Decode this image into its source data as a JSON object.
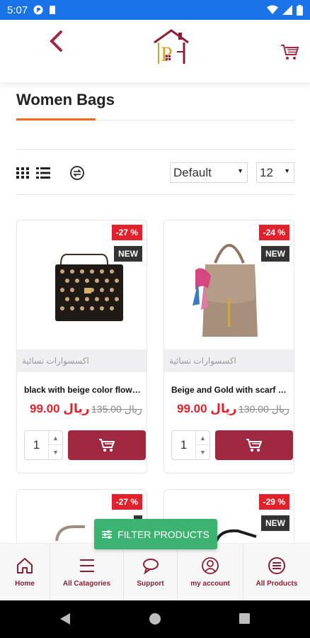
{
  "status_bar": {
    "time": "5:07"
  },
  "header": {
    "back_icon": "chevron-left-icon",
    "logo_letter": "P",
    "cart_icon": "cart-icon"
  },
  "page": {
    "title": "Women Bags"
  },
  "toolbar": {
    "grid_icon": "grid-view-icon",
    "list_icon": "list-view-icon",
    "compare_icon": "sync-icon",
    "sort": {
      "selected": "Default"
    },
    "per_page": {
      "selected": "12"
    }
  },
  "products": [
    {
      "discount": "-27 %",
      "badge": "NEW",
      "category": "اكسسوارات نسائية",
      "name": "black with beige color flowe...",
      "price": "99.00 ريال",
      "old_price": "135.00 ريال",
      "qty": "1"
    },
    {
      "discount": "-24 %",
      "badge": "NEW",
      "category": "اكسسوارات نسائية",
      "name": "Beige and Gold with scarf w...",
      "price": "99.00 ريال",
      "old_price": "130.00 ريال",
      "qty": "1"
    },
    {
      "discount": "-27 %",
      "badge": ""
    },
    {
      "discount": "-29 %",
      "badge": "NEW"
    }
  ],
  "filter_button": {
    "label": "FILTER PRODUCTS"
  },
  "bottom_nav": [
    {
      "label": "Home",
      "icon": "home-icon"
    },
    {
      "label": "All Catagories",
      "icon": "menu-icon"
    },
    {
      "label": "Support",
      "icon": "chat-icon"
    },
    {
      "label": "my account",
      "icon": "user-icon"
    },
    {
      "label": "All Products",
      "icon": "list-circle-icon"
    }
  ],
  "colors": {
    "status_bar": "#1a73e8",
    "brand": "#a12841",
    "discount": "#e1222c",
    "accent": "#f06a22",
    "filter": "#3cb371"
  }
}
